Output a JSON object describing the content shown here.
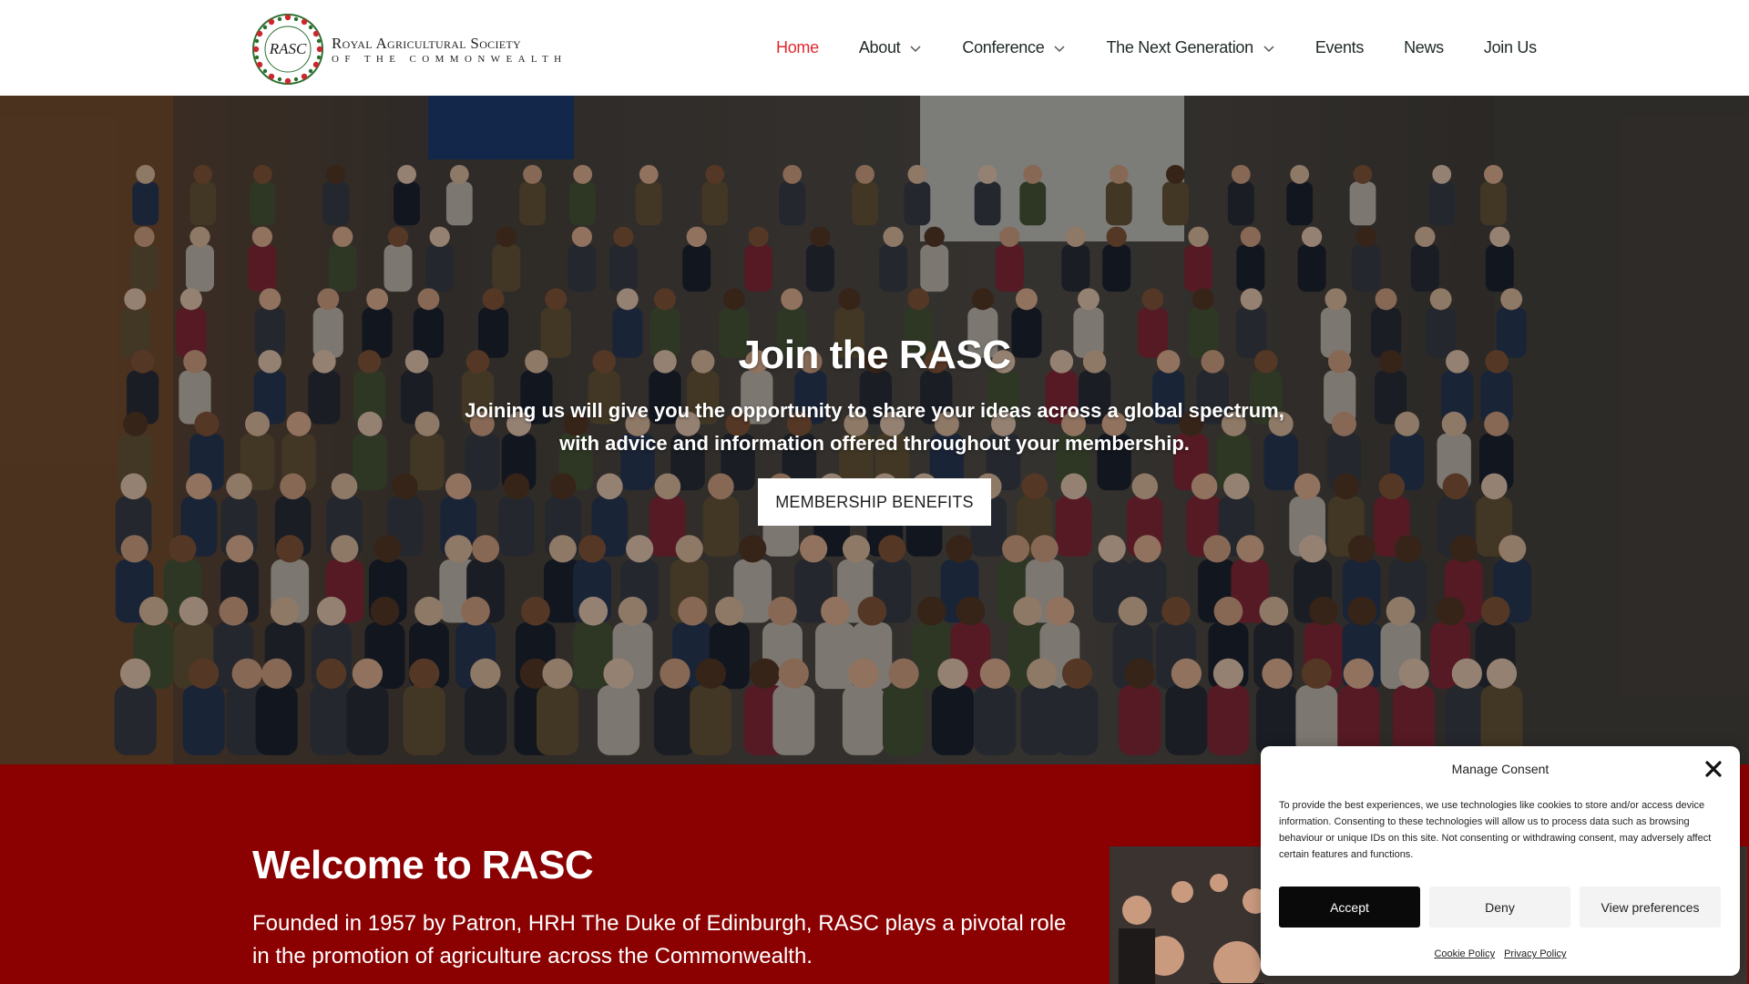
{
  "header": {
    "logo": {
      "seal_letters": "RASC",
      "line1": "Royal Agricultural Society",
      "line2": "of the Commonwealth"
    },
    "nav": [
      {
        "label": "Home",
        "active": true,
        "dropdown": false
      },
      {
        "label": "About",
        "active": false,
        "dropdown": true
      },
      {
        "label": "Conference",
        "active": false,
        "dropdown": true
      },
      {
        "label": "The Next Generation",
        "active": false,
        "dropdown": true
      },
      {
        "label": "Events",
        "active": false,
        "dropdown": false
      },
      {
        "label": "News",
        "active": false,
        "dropdown": false
      },
      {
        "label": "Join Us",
        "active": false,
        "dropdown": false
      }
    ]
  },
  "hero": {
    "title": "Join the RASC",
    "subtitle_line1": "Joining us will give you the opportunity to share your ideas across a global spectrum,",
    "subtitle_line2": "with advice and information offered throughout your membership.",
    "button_label": "MEMBERSHIP BENEFITS"
  },
  "welcome": {
    "title": "Welcome to RASC",
    "text": "Founded in 1957 by Patron, HRH The Duke of Edinburgh, RASC plays a pivotal role in the promotion of agriculture across the Commonwealth."
  },
  "consent": {
    "title": "Manage Consent",
    "body": "To provide the best experiences, we use technologies like cookies to store and/or access device information. Consenting to these technologies will allow us to process data such as browsing behaviour or unique IDs on this site. Not consenting or withdrawing consent, may adversely affect certain features and functions.",
    "buttons": {
      "accept": "Accept",
      "deny": "Deny",
      "preferences": "View preferences"
    },
    "links": {
      "cookie": "Cookie Policy",
      "privacy": "Privacy Policy"
    }
  },
  "colors": {
    "nav_active": "#e0292f",
    "welcome_bg": "#8b0000",
    "accept_bg": "#0a0a0a"
  }
}
